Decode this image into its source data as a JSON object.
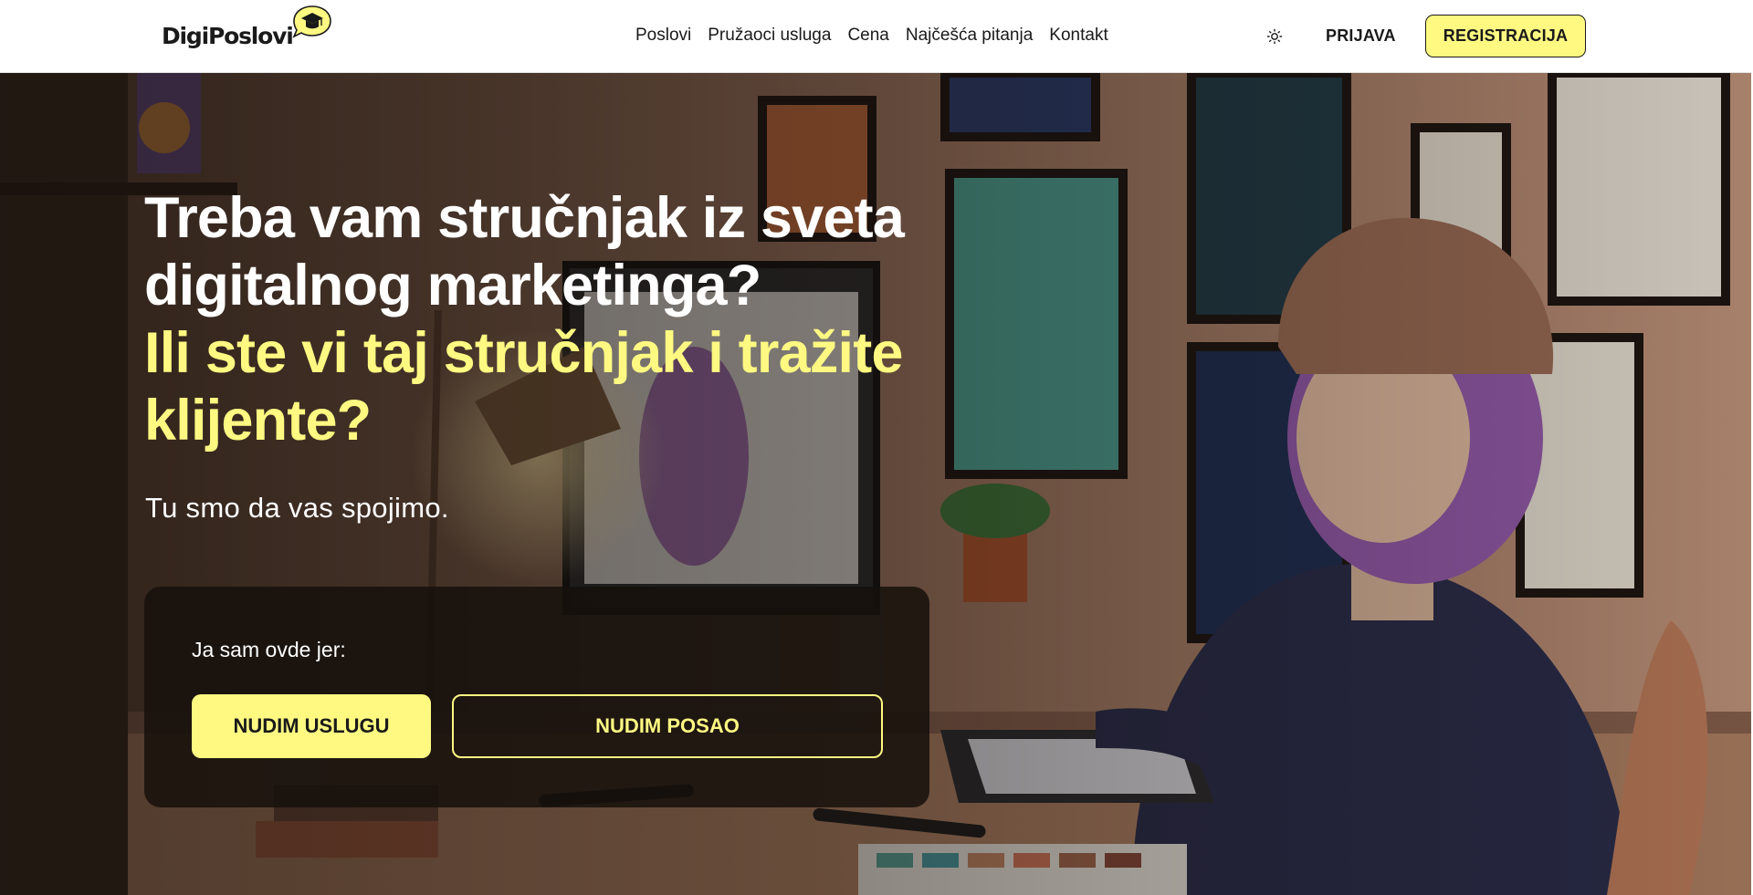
{
  "header": {
    "brand": "DigiPoslovi",
    "nav": [
      {
        "label": "Poslovi"
      },
      {
        "label": "Pružaoci usluga"
      },
      {
        "label": "Cena"
      },
      {
        "label": "Najčešća pitanja"
      },
      {
        "label": "Kontakt"
      }
    ],
    "theme_icon": "sun-icon",
    "login_label": "PRIJAVA",
    "register_label": "REGISTRACIJA"
  },
  "hero": {
    "headline_white_1": "Treba vam stručnjak iz sveta",
    "headline_white_2": "digitalnog marketinga?",
    "headline_yellow_1": "Ili ste vi taj stručnjak i tražite",
    "headline_yellow_2": "klijente?",
    "subline": "Tu smo da vas spojimo.",
    "choice": {
      "label": "Ja sam ovde jer:",
      "primary_label": "NUDIM USLUGU",
      "secondary_label": "NUDIM POSAO"
    },
    "background_image": "illustrated-woman-drawing-on-tablet-illustration"
  },
  "colors": {
    "accent_yellow": "#fff982",
    "text_dark": "#1a1a1a",
    "panel_dark": "#16100c"
  }
}
